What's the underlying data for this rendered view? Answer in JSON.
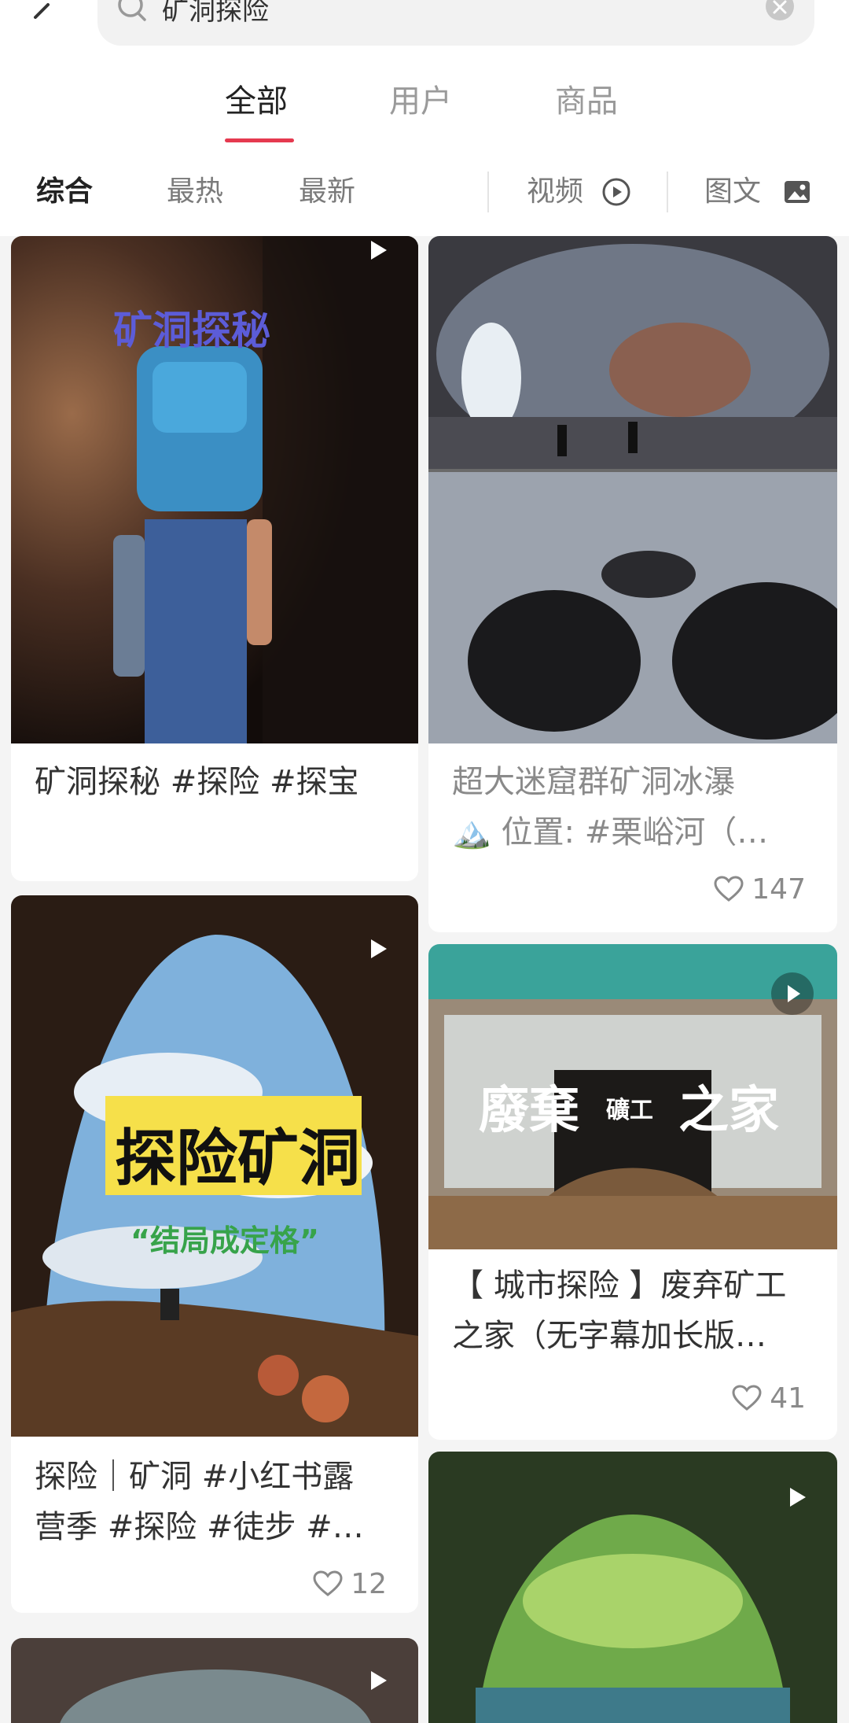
{
  "search": {
    "query": "矿洞探险"
  },
  "tabs": [
    "全部",
    "用户",
    "商品"
  ],
  "filters": {
    "comprehensive": "综合",
    "hottest": "最热",
    "newest": "最新",
    "video": "视频",
    "image_text": "图文"
  },
  "accent_color": "#e5394f",
  "cards": [
    {
      "title": "矿洞探秘 #探险  #探宝",
      "overlay": "矿洞探秘"
    },
    {
      "title_line1": "超大迷窟群矿洞冰瀑",
      "title_line2": "🏔️ 位置: #栗峪河（…",
      "likes": "147"
    },
    {
      "title_line1": "探险｜矿洞 #小红书露",
      "title_line2": "营季 #探险  #徒步  #…",
      "likes": "12",
      "overlay_main": "探险矿洞",
      "overlay_sub": "“结局成定格”"
    },
    {
      "title_line1": "【 城市探险 】废弃矿工",
      "title_line2": "之家（无字幕加长版…",
      "likes": "41",
      "overlay_a": "廢棄",
      "overlay_b": "礦工",
      "overlay_c": "之家"
    }
  ]
}
